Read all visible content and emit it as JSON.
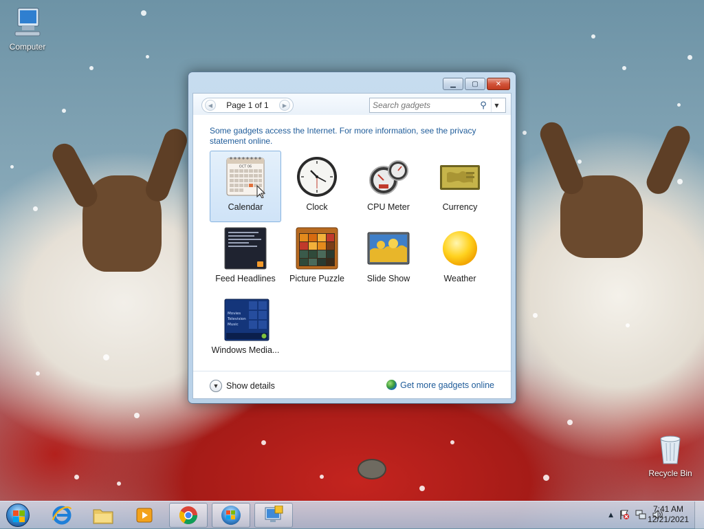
{
  "desktop": {
    "icons": [
      {
        "label": "Computer"
      },
      {
        "label": "Recycle Bin"
      }
    ]
  },
  "window": {
    "controls": {
      "minimize": "minimize-icon",
      "maximize": "maximize-icon",
      "close": "close-icon"
    },
    "pager": {
      "label": "Page 1 of 1"
    },
    "search": {
      "placeholder": "Search gadgets"
    },
    "notice": "Some gadgets access the Internet.  For more information, see the privacy statement online.",
    "gadgets": [
      {
        "label": "Calendar",
        "selected": true
      },
      {
        "label": "Clock"
      },
      {
        "label": "CPU Meter"
      },
      {
        "label": "Currency"
      },
      {
        "label": "Feed Headlines"
      },
      {
        "label": "Picture Puzzle"
      },
      {
        "label": "Slide Show"
      },
      {
        "label": "Weather"
      },
      {
        "label": "Windows Media..."
      }
    ],
    "calendar_thumb": {
      "month": "OCT 06"
    },
    "media_thumb": {
      "lines": [
        "Movies",
        "Television",
        "Music"
      ]
    },
    "footer": {
      "show_details": "Show details",
      "more_online": "Get more gadgets online"
    }
  },
  "taskbar": {
    "clock": {
      "time": "7:41 AM",
      "date": "12/21/2021"
    },
    "tray_up_arrow": "▲"
  }
}
